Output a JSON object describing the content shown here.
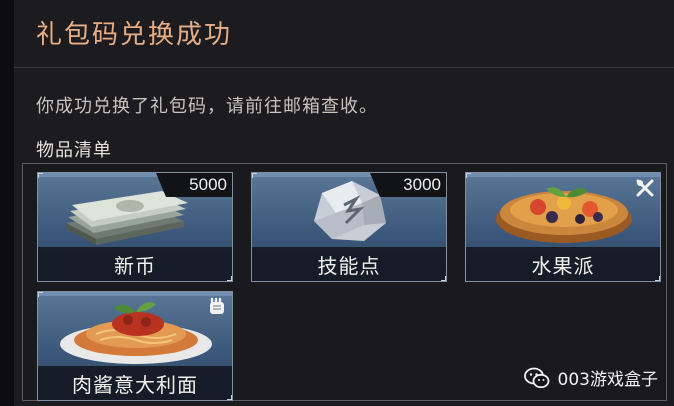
{
  "dialog": {
    "title": "礼包码兑换成功",
    "message": "你成功兑换了礼包码，请前往邮箱查收。",
    "section_label": "物品清单"
  },
  "items": [
    {
      "name": "新币",
      "quantity": "5000",
      "icon": "cash-stack-icon"
    },
    {
      "name": "技能点",
      "quantity": "3000",
      "icon": "skill-crystal-icon"
    },
    {
      "name": "水果派",
      "icon": "fruit-pie-icon",
      "badge_icon": "crossed-utensils-icon"
    },
    {
      "name": "肉酱意大利面",
      "icon": "spaghetti-bolognese-icon",
      "badge_icon": "fist-icon"
    }
  ],
  "watermark": {
    "text": "003游戏盒子",
    "icon": "wechat-icon"
  },
  "colors": {
    "title": "#e7ad85",
    "card_blue": "#3c587a",
    "background": "#1c1b1f"
  }
}
